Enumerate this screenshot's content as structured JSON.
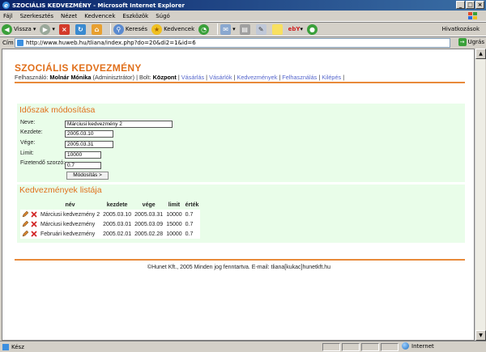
{
  "window": {
    "title": "SZOCIÁLIS KEDVEZMÉNY - Microsoft Internet Explorer",
    "buttons": [
      "_",
      "□",
      "×"
    ]
  },
  "menu": [
    "Fájl",
    "Szerkesztés",
    "Nézet",
    "Kedvencek",
    "Eszközök",
    "Súgó"
  ],
  "toolbar": {
    "back_label": "Vissza",
    "search_label": "Keresés",
    "favorites_label": "Kedvencek",
    "links_label": "Hivatkozások"
  },
  "address": {
    "label": "Cím",
    "url": "http://www.huweb.hu/tliana/index.php?do=20&di2=1&id=6",
    "go_label": "Ugrás"
  },
  "page": {
    "site_title": "SZOCIÁLIS KEDVEZMÉNY",
    "user_prefix": "Felhasználó:",
    "user_name": "Molnár Mónika",
    "user_role": "(Adminisztrátor)",
    "shop_prefix": "| Bolt:",
    "shop_name": "Központ",
    "nav": [
      "Vásárlás",
      "Vásárlók",
      "Kedvezmények",
      "Felhasználás",
      "Kilépés"
    ],
    "edit_section": {
      "title": "Időszak módosítása",
      "fields": {
        "name_label": "Neve:",
        "name_value": "Márciusi kedvezmény 2",
        "start_label": "Kezdete:",
        "start_value": "2005.03.10",
        "end_label": "Vége:",
        "end_value": "2005.03.31",
        "limit_label": "Limit:",
        "limit_value": "10000",
        "ratio_label": "Fizetendő szorzó:",
        "ratio_value": "0.7"
      },
      "submit_label": "Módosítás >"
    },
    "list_section": {
      "title": "Kedvezmények listája",
      "columns": [
        "név",
        "kezdete",
        "vége",
        "limit",
        "érték"
      ],
      "rows": [
        [
          "Márciusi kedvezmény 2",
          "2005.03.10",
          "2005.03.31",
          "10000",
          "0.7"
        ],
        [
          "Márciusi kedvezmény",
          "2005.03.01",
          "2005.03.09",
          "15000",
          "0.7"
        ],
        [
          "Februári kedvezmény",
          "2005.02.01",
          "2005.02.28",
          "10000",
          "0.7"
        ]
      ]
    },
    "footer": "©Hunet Kft., 2005 Minden jog fenntartva. E-mail: tliana[kukac]hunetkft.hu"
  },
  "status": {
    "text": "Kész",
    "zone": "Internet"
  },
  "colors": {
    "accent": "#e0701c",
    "panel_bg": "#e9fde9",
    "link": "#5566cc"
  }
}
